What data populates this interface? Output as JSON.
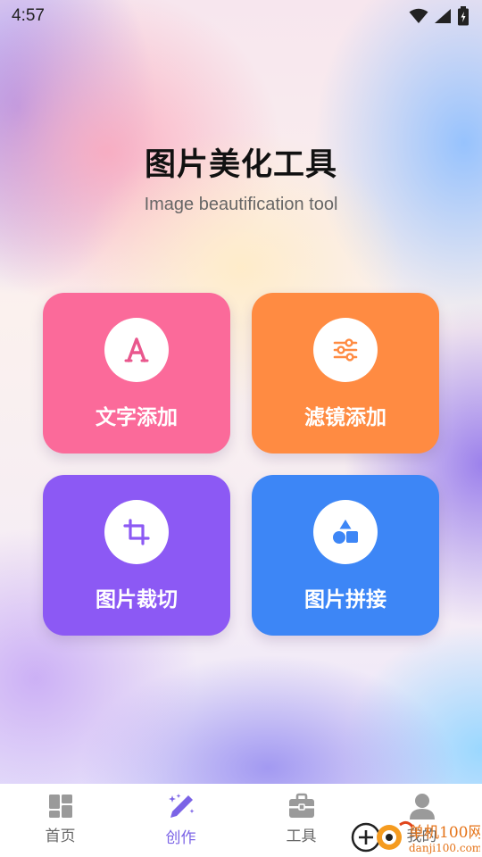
{
  "status_bar": {
    "time": "4:57"
  },
  "header": {
    "title": "图片美化工具",
    "subtitle": "Image beautification tool"
  },
  "tools": [
    {
      "label": "文字添加",
      "icon": "text-icon",
      "color": "#fb6a9a"
    },
    {
      "label": "滤镜添加",
      "icon": "sliders-icon",
      "color": "#ff8b42"
    },
    {
      "label": "图片裁切",
      "icon": "crop-icon",
      "color": "#8c59f4"
    },
    {
      "label": "图片拼接",
      "icon": "shapes-icon",
      "color": "#3d86f6"
    }
  ],
  "nav": {
    "items": [
      {
        "label": "首页",
        "icon": "dashboard-icon",
        "active": false
      },
      {
        "label": "创作",
        "icon": "magic-pen-icon",
        "active": true
      },
      {
        "label": "工具",
        "icon": "toolbox-icon",
        "active": false
      },
      {
        "label": "我的",
        "icon": "person-icon",
        "active": false
      }
    ]
  },
  "watermark": {
    "text_cn": "单机100网",
    "text_url": "danji100.com"
  },
  "colors": {
    "accent": "#7b63e6",
    "inactive_icon": "#9a9a9a"
  }
}
